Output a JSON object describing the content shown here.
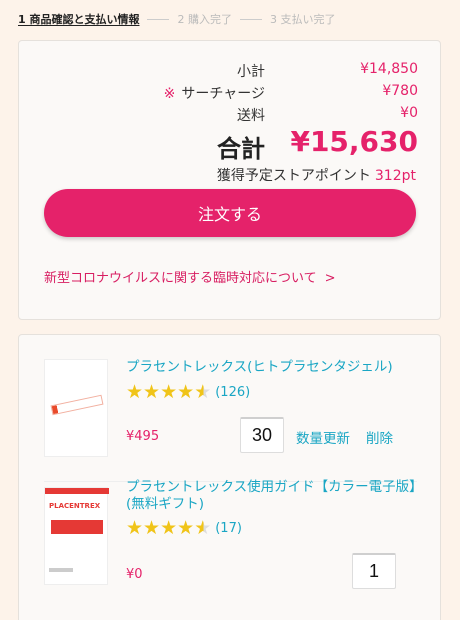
{
  "steps": [
    {
      "label": "1 商品確認と支払い情報"
    },
    {
      "label": "2 購入完了"
    },
    {
      "label": "3 支払い完了"
    }
  ],
  "summary": {
    "subtotal_label": "小計",
    "subtotal_value": "¥14,850",
    "surcharge_mark": "※",
    "surcharge_label": "サーチャージ",
    "surcharge_value": "¥780",
    "shipping_label": "送料",
    "shipping_value": "¥0",
    "total_label": "合計",
    "total_value": "¥15,630",
    "points_label": "獲得予定ストアポイント",
    "points_value": "312pt",
    "order_button": "注文する",
    "notice_text": "新型コロナウイルスに関する臨時対応について",
    "notice_arrow": ">"
  },
  "items": [
    {
      "name": "プラセントレックス(ヒトプラセンタジェル)",
      "rating": 4.5,
      "review_count": "(126)",
      "price": "¥495",
      "quantity": "30",
      "update_label": "数量更新",
      "delete_label": "削除"
    },
    {
      "name": "プラセントレックス使用ガイド【カラー電子版】(無料ギフト)",
      "rating": 4.5,
      "review_count": "(17)",
      "price": "¥0",
      "quantity": "1"
    }
  ],
  "colors": {
    "accent": "#e5226a",
    "link": "#1aa6c4",
    "star": "#f0c419",
    "background": "#fdf3ea"
  }
}
